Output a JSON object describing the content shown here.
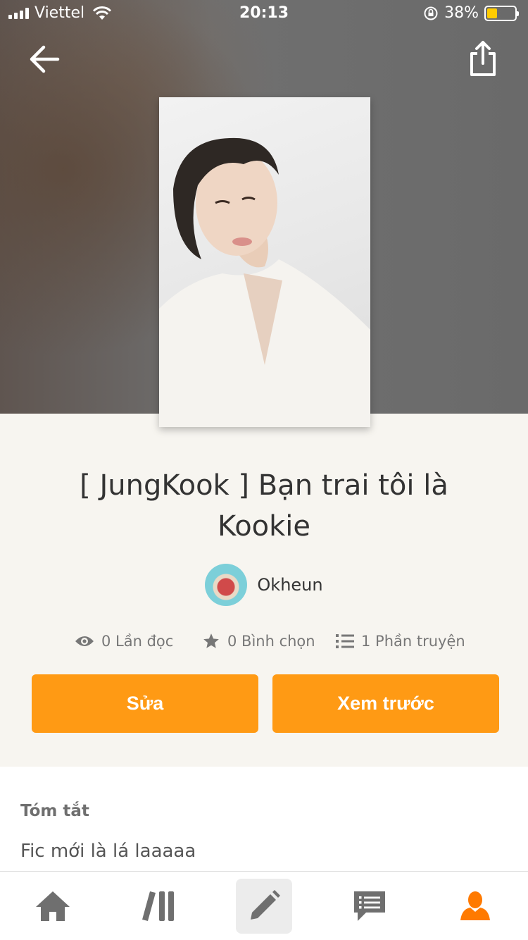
{
  "status_bar": {
    "carrier": "Viettel",
    "time": "20:13",
    "battery_percent": "38%",
    "battery_level": 0.38,
    "icons": [
      "signal-icon",
      "wifi-icon",
      "rotation-lock-icon",
      "battery-icon"
    ]
  },
  "header": {
    "back_icon": "arrow-left-icon",
    "share_icon": "share-icon"
  },
  "story": {
    "title": "[ JungKook ] Bạn trai tôi là Kookie",
    "author": "Okheun",
    "stats": {
      "reads": "0 Lần đọc",
      "votes": "0 Bình chọn",
      "parts": "1 Phần truyện"
    }
  },
  "actions": {
    "edit_label": "Sửa",
    "preview_label": "Xem trước"
  },
  "summary": {
    "heading": "Tóm tắt",
    "text": "Fic mới là lá laaaaa"
  },
  "tabbar": {
    "items": [
      "home-icon",
      "library-icon",
      "write-icon",
      "messages-icon",
      "profile-icon"
    ],
    "active": "write-icon"
  },
  "colors": {
    "accent": "#ff9a14",
    "active_tab_icon": "#ff7a00",
    "inactive_tab_icon": "#6f6f6f",
    "background": "#f7f5f0"
  }
}
